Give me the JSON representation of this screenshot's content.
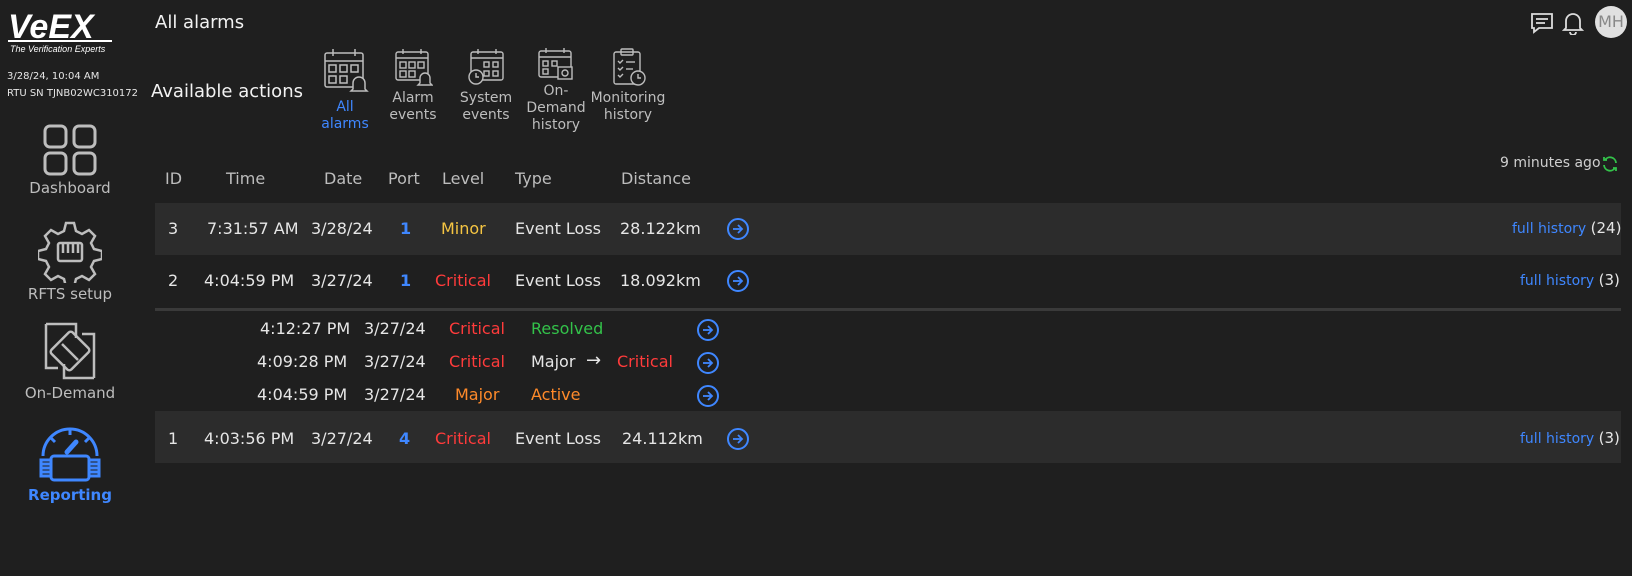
{
  "brand": {
    "name": "VeEX",
    "tagline": "The Verification Experts"
  },
  "status": {
    "datetime": "3/28/24, 10:04 AM",
    "rtu": "RTU SN TJNB02WC310172"
  },
  "nav": {
    "items": [
      {
        "label": "Dashboard"
      },
      {
        "label": "RFTS setup"
      },
      {
        "label": "On-Demand"
      },
      {
        "label": "Reporting"
      }
    ]
  },
  "header": {
    "title": "All alarms",
    "avatar_initials": "MH"
  },
  "actions": {
    "title": "Available actions",
    "items": [
      {
        "line1": "All",
        "line2": "alarms",
        "line3": ""
      },
      {
        "line1": "Alarm",
        "line2": "events",
        "line3": ""
      },
      {
        "line1": "System",
        "line2": "events",
        "line3": ""
      },
      {
        "line1": "On-",
        "line2": "Demand",
        "line3": "history"
      },
      {
        "line1": "Monitoring",
        "line2": "history",
        "line3": ""
      }
    ]
  },
  "refresh": {
    "text": "9 minutes ago"
  },
  "table": {
    "columns": [
      "ID",
      "Time",
      "Date",
      "Port",
      "Level",
      "Type",
      "Distance"
    ],
    "rows": [
      {
        "id": "3",
        "time": "7:31:57 AM",
        "date": "3/28/24",
        "port": "1",
        "level": "Minor",
        "type": "Event Loss",
        "distance": "28.122km",
        "history_link": "full history",
        "history_count": "(24)"
      },
      {
        "id": "2",
        "time": "4:04:59 PM",
        "date": "3/27/24",
        "port": "1",
        "level": "Critical",
        "type": "Event Loss",
        "distance": "18.092km",
        "history_link": "full history",
        "history_count": "(3)"
      },
      {
        "id": "1",
        "time": "4:03:56 PM",
        "date": "3/27/24",
        "port": "4",
        "level": "Critical",
        "type": "Event Loss",
        "distance": "24.112km",
        "history_link": "full history",
        "history_count": "(3)"
      }
    ],
    "history": [
      {
        "time": "4:12:27 PM",
        "date": "3/27/24",
        "level": "Critical",
        "status": "Resolved",
        "arrow": "",
        "to": ""
      },
      {
        "time": "4:09:28 PM",
        "date": "3/27/24",
        "level": "Critical",
        "status": "Major",
        "arrow": "→",
        "to": "Critical"
      },
      {
        "time": "4:04:59 PM",
        "date": "3/27/24",
        "level": "Major",
        "status": "Active",
        "arrow": "",
        "to": ""
      }
    ]
  },
  "colors": {
    "accent": "#3f87ff",
    "minor": "#f5c542",
    "critical": "#ff3b3b",
    "major": "#ff8a2a",
    "resolved": "#33c24a",
    "refresh": "#33c24a"
  }
}
